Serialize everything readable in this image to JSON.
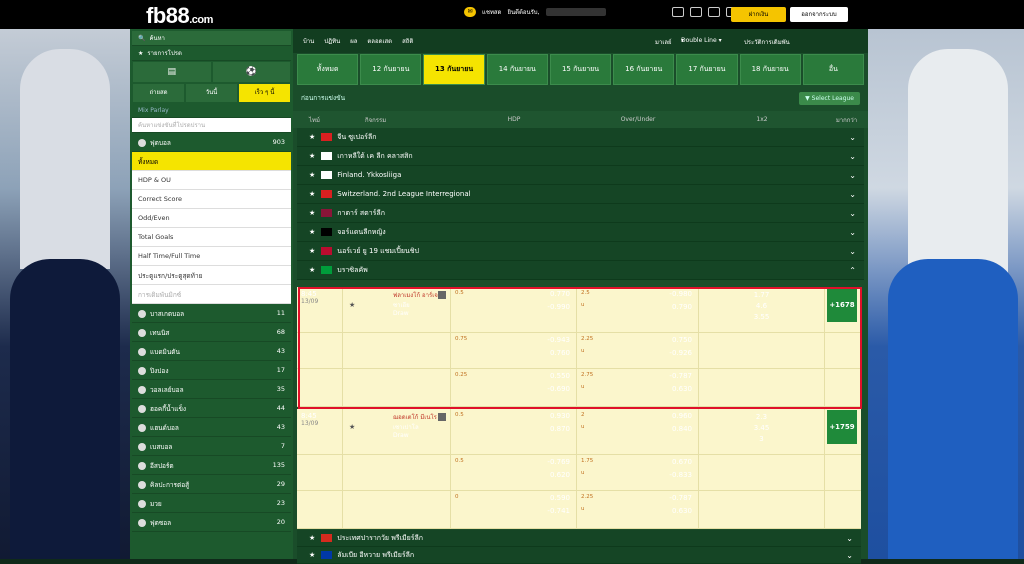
{
  "header": {
    "logo_main": "fb88",
    "logo_suffix": ".com",
    "chat": "แชทสด",
    "welcome": "ยินดีต้อนรับ,",
    "deposit": "ฝากเงิน",
    "logout": "ออกจากระบบ"
  },
  "left_menu": {
    "search": "ค้นหา",
    "favorites": "รายการโปรด",
    "tabs": [
      "ถ่ายสด",
      "วันนี้",
      "เร็ว ๆ นี้"
    ],
    "mix_parlay": "Mix Parlay",
    "search_league": "ค้นหาแข่งขันที่โปรดปราน",
    "football": {
      "label": "ฟุตบอล",
      "count": "903"
    },
    "bet_types": [
      "ทั้งหมด",
      "HDP & OU",
      "Correct Score",
      "Odd/Even",
      "Total Goals",
      "Half Time/Full Time",
      "ประตูแรก/ประตูสุดท้าย",
      "การเดิมพันมิกซ์"
    ],
    "sports": [
      {
        "label": "บาสเกตบอล",
        "count": "11"
      },
      {
        "label": "เทนนิส",
        "count": "68"
      },
      {
        "label": "แบดมินตัน",
        "count": "43"
      },
      {
        "label": "ปิงปอง",
        "count": "17"
      },
      {
        "label": "วอลเลย์บอล",
        "count": "35"
      },
      {
        "label": "ฮอคกี้น้ำแข็ง",
        "count": "44"
      },
      {
        "label": "แฮนด์บอล",
        "count": "43"
      },
      {
        "label": "เบสบอล",
        "count": "7"
      },
      {
        "label": "อีสปอร์ต",
        "count": "135"
      },
      {
        "label": "คิลปะการต่อสู้",
        "count": "29"
      },
      {
        "label": "มวย",
        "count": "23"
      },
      {
        "label": "ฟุตซอล",
        "count": "20"
      }
    ]
  },
  "nav": {
    "links": [
      "บ้าน",
      "ปฏิทิน",
      "ผล",
      "ตลอดเสด",
      "สถิติ"
    ],
    "lang": "มาเลย์",
    "odds_type": "Double Line",
    "history": "ประวัติการเดิมพัน"
  },
  "date_tabs": [
    "ทั้งหมด",
    "12 กันยายน",
    "13 กันยายน",
    "14 กันยายน",
    "15 กันยายน",
    "16 กันยายน",
    "17 กันยายน",
    "18 กันยายน",
    "อื่น"
  ],
  "subhead": {
    "title": "ก่อนการแข่งขัน",
    "select_league": "Select League"
  },
  "columns": [
    "ไทม์",
    "กิจกรรม",
    "HDP",
    "Over/Under",
    "1x2",
    "มากกว่า"
  ],
  "leagues": [
    {
      "name": "จีน ซูเปอร์ลีก",
      "flag": "#d92020"
    },
    {
      "name": "เกาหลีใต้ เค ลีก คลาสสิก",
      "flag": "#ffffff"
    },
    {
      "name": "Finland. Ykkosliiga",
      "flag": "#ffffff"
    },
    {
      "name": "Switzerland. 2nd League Interregional",
      "flag": "#d92020"
    },
    {
      "name": "กาตาร์ สตาร์ลีก",
      "flag": "#8a1538"
    },
    {
      "name": "จอร์แดนลีกหญิง",
      "flag": "#000000"
    },
    {
      "name": "นอร์เวย์ ยู 19 แชมเปี้ยนชิป",
      "flag": "#ba0c2f"
    },
    {
      "name": "บราซิลคัพ",
      "flag": "#009c3b"
    }
  ],
  "match1": {
    "time": "8:45",
    "date": "13/09",
    "home": "ฟลาเมงโก้ อาร์เจ",
    "away": "ซาเอีย",
    "draw": "Draw",
    "more": "+1678",
    "rows": [
      {
        "hdp_line": "0.5",
        "hdp1": "0.770",
        "hdp2": "-0.990",
        "ou_line": "2.5",
        "ou_u": "u",
        "ou1": "-0.980",
        "ou2": "0.790",
        "x1": "1.77",
        "x2": "4.6",
        "x3": "3.55"
      },
      {
        "hdp_line": "0.75",
        "hdp1": "-0.943",
        "hdp2": "0.760",
        "ou_line": "2.25",
        "ou_u": "u",
        "ou1": "0.750",
        "ou2": "-0.926"
      },
      {
        "hdp_line": "0.25",
        "hdp1": "0.550",
        "hdp2": "-0.690",
        "ou_line": "2.75",
        "ou_u": "u",
        "ou1": "-0.787",
        "ou2": "0.630"
      }
    ]
  },
  "match2": {
    "time": "8:45",
    "date": "13/09",
    "home": "ฌอดเตโก้ มีเนโร",
    "away": "เซาเปาโล",
    "draw": "Draw",
    "more": "+1759",
    "rows": [
      {
        "hdp_line": "0.5",
        "hdp1": "0.930",
        "hdp2": "0.870",
        "ou_line": "2",
        "ou_u": "u",
        "ou1": "0.960",
        "ou2": "0.840",
        "x1": "2.3",
        "x2": "3.45",
        "x3": "3"
      },
      {
        "hdp_line": "0.5",
        "hdp1": "-0.769",
        "hdp2": "0.620",
        "ou_line": "1.75",
        "ou_u": "u",
        "ou1": "0.670",
        "ou2": "-0.833"
      },
      {
        "hdp_line": "0",
        "hdp1": "0.590",
        "hdp2": "-0.741",
        "ou_line": "2.25",
        "ou_u": "u",
        "ou1": "-0.787",
        "ou2": "0.630"
      }
    ]
  },
  "bottom_leagues": [
    {
      "name": "ประเทศปารากวัย พรีเมียร์ลีก",
      "flag": "#d52b1e"
    },
    {
      "name": "ลัมเบีย อีหวาย พรีเมียร์ลีก",
      "flag": "#0038a8"
    }
  ]
}
